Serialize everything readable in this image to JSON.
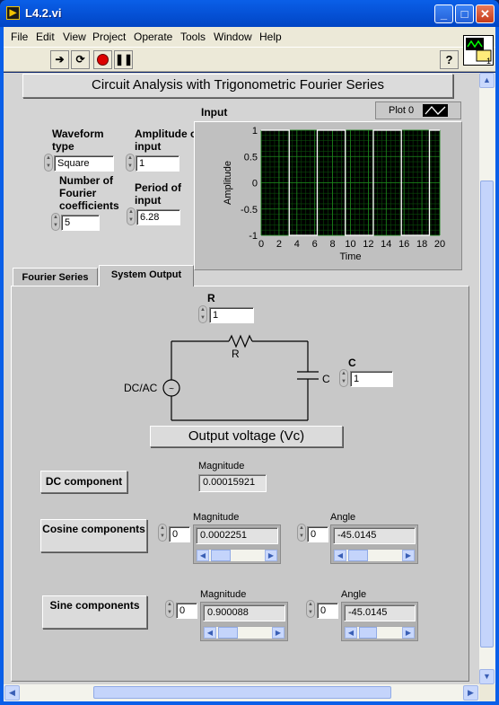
{
  "window": {
    "title": "L4.2.vi"
  },
  "menu": [
    "File",
    "Edit",
    "View",
    "Project",
    "Operate",
    "Tools",
    "Window",
    "Help"
  ],
  "panel": {
    "banner": "Circuit Analysis with Trigonometric Fourier Series",
    "waveform_type": {
      "label": "Waveform type",
      "value": "Square"
    },
    "amplitude": {
      "label": "Amplitude of input",
      "value": "1"
    },
    "num_coeffs": {
      "label": "Number of Fourier coefficients",
      "value": "5"
    },
    "period": {
      "label": "Period of input",
      "value": "6.28"
    },
    "graph_title": "Input",
    "plot_legend": "Plot 0"
  },
  "tabs": [
    {
      "label": "Fourier Series",
      "active": false
    },
    {
      "label": "System Output",
      "active": true
    }
  ],
  "system_output": {
    "r_label": "R",
    "r_value": "1",
    "c_label": "C",
    "c_value": "1",
    "circuit": {
      "source_label": "DC/AC",
      "resistor_label": "R",
      "capacitor_label": "C"
    },
    "output_button": "Output voltage (Vc)",
    "dc": {
      "button": "DC component",
      "magnitude_label": "Magnitude",
      "magnitude": "0.00015921"
    },
    "cosine": {
      "button": "Cosine components",
      "index_mag": "0",
      "magnitude_label": "Magnitude",
      "magnitude": "0.0002251",
      "index_ang": "0",
      "angle_label": "Angle",
      "angle": "-45.0145"
    },
    "sine": {
      "button": "Sine components",
      "index_mag": "0",
      "magnitude_label": "Magnitude",
      "magnitude": "0.900088",
      "index_ang": "0",
      "angle_label": "Angle",
      "angle": "-45.0145"
    }
  },
  "chart_data": {
    "type": "line",
    "title": "Input",
    "xlabel": "Time",
    "ylabel": "Amplitude",
    "xlim": [
      0,
      20
    ],
    "ylim": [
      -1,
      1
    ],
    "x_ticks": [
      "0",
      "2",
      "4",
      "6",
      "8",
      "10",
      "12",
      "14",
      "16",
      "18",
      "20"
    ],
    "y_ticks": [
      "1",
      "0.5",
      "0",
      "-0.5",
      "-1"
    ],
    "grid": true,
    "series": [
      {
        "name": "Plot 0",
        "color": "#FFFFFF",
        "x": [
          0,
          3.14,
          3.14,
          6.28,
          6.28,
          9.42,
          9.42,
          12.56,
          12.56,
          15.7,
          15.7,
          18.84,
          18.84,
          20
        ],
        "y": [
          1,
          1,
          -1,
          -1,
          1,
          1,
          -1,
          -1,
          1,
          1,
          -1,
          -1,
          1,
          1
        ]
      }
    ]
  }
}
